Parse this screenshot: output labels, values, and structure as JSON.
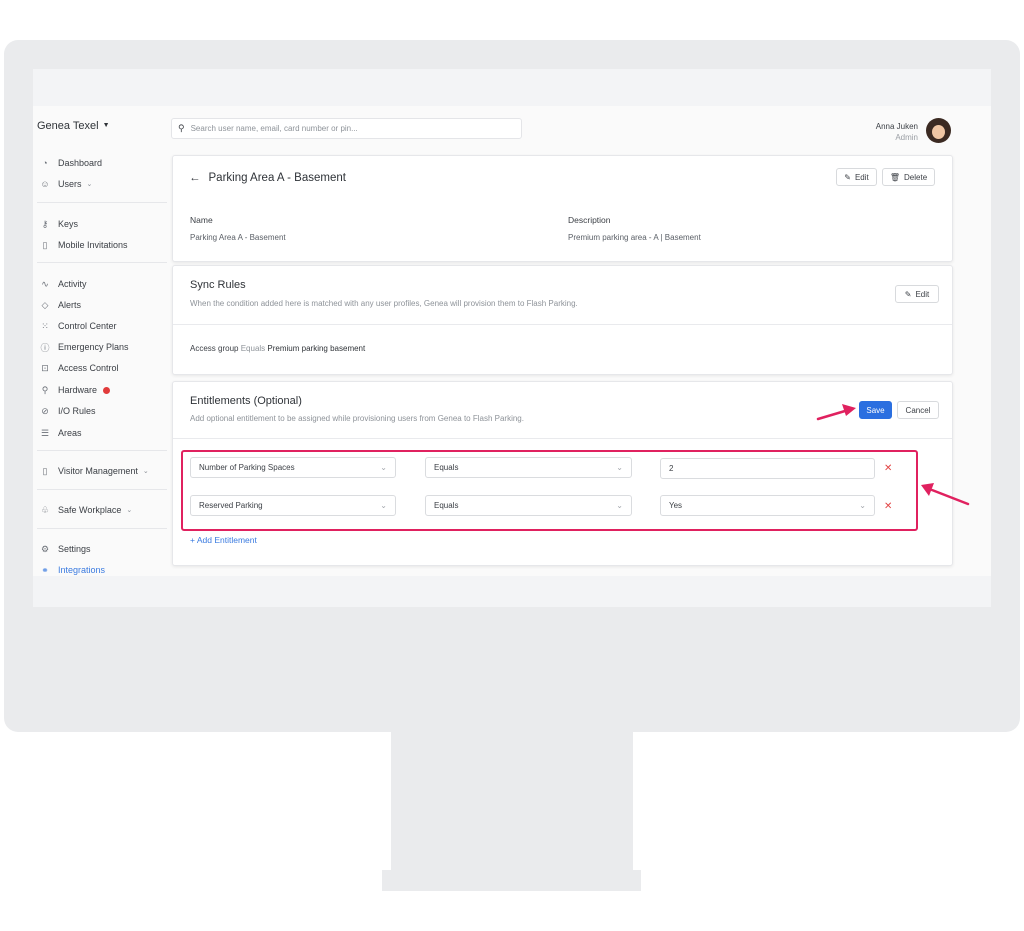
{
  "sidebar": {
    "brand": "Genea Texel",
    "items": [
      {
        "label": "Dashboard",
        "icon": "gauge-icon"
      },
      {
        "label": "Users",
        "icon": "users-icon"
      },
      {
        "label": "Keys",
        "icon": "key-icon"
      },
      {
        "label": "Mobile Invitations",
        "icon": "mobile-icon"
      },
      {
        "label": "Activity",
        "icon": "activity-icon"
      },
      {
        "label": "Alerts",
        "icon": "alert-icon"
      },
      {
        "label": "Control Center",
        "icon": "control-center-icon"
      },
      {
        "label": "Emergency Plans",
        "icon": "emergency-icon"
      },
      {
        "label": "Access Control",
        "icon": "lock-icon"
      },
      {
        "label": "Hardware",
        "icon": "hardware-icon"
      },
      {
        "label": "I/O Rules",
        "icon": "io-rules-icon"
      },
      {
        "label": "Areas",
        "icon": "areas-icon"
      },
      {
        "label": "Visitor Management",
        "icon": "visitor-icon"
      },
      {
        "label": "Safe Workplace",
        "icon": "workplace-icon"
      },
      {
        "label": "Settings",
        "icon": "gear-icon"
      },
      {
        "label": "Integrations",
        "icon": "link-icon"
      }
    ],
    "active_color": "#3b7be0",
    "alert_dot_color": "#e13b3b"
  },
  "header": {
    "search_placeholder": "Search user name, email, card number or pin...",
    "user_name": "Anna Juken",
    "user_role": "Admin"
  },
  "detail": {
    "title": "Parking Area A - Basement",
    "edit_label": "Edit",
    "delete_label": "Delete",
    "name_label": "Name",
    "name_value": "Parking Area A - Basement",
    "description_label": "Description",
    "description_value": "Premium parking area - A | Basement"
  },
  "sync": {
    "title": "Sync Rules",
    "subtitle": "When the condition added here is matched with any user profiles, Genea will provision them to Flash Parking.",
    "edit_label": "Edit",
    "rule_field": "Access group",
    "rule_operator": "Equals",
    "rule_value": "Premium parking basement"
  },
  "entitlements": {
    "title": "Entitlements (Optional)",
    "subtitle": "Add optional entitlement to be assigned while provisioning users from Genea to Flash Parking.",
    "save_label": "Save",
    "cancel_label": "Cancel",
    "rows": [
      {
        "field": "Number of Parking Spaces",
        "operator": "Equals",
        "value": "2",
        "value_type": "input"
      },
      {
        "field": "Reserved Parking",
        "operator": "Equals",
        "value": "Yes",
        "value_type": "select"
      }
    ],
    "add_label": "+ Add Entitlement"
  },
  "colors": {
    "primary": "#2b6fe0",
    "highlight": "#e0215f",
    "remove": "#e24444"
  }
}
